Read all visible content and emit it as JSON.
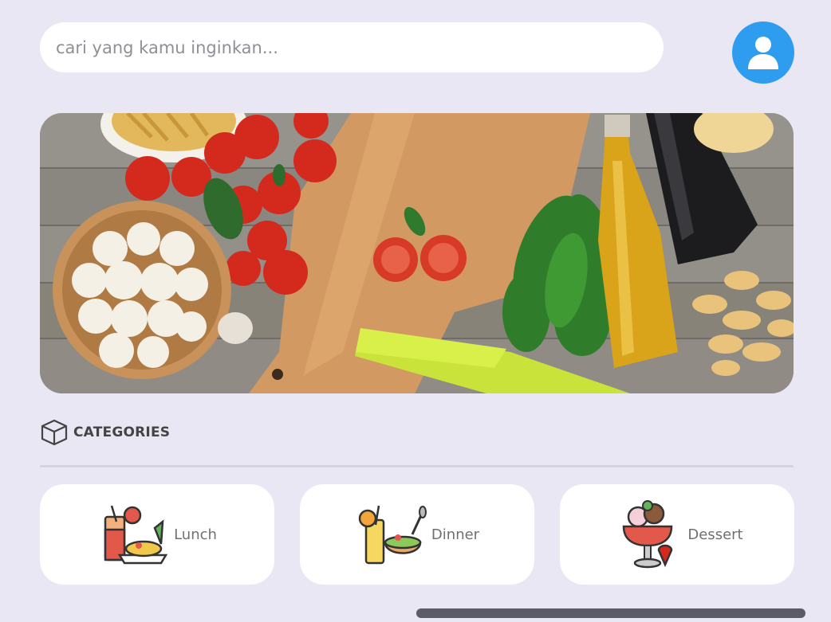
{
  "search": {
    "placeholder": "cari yang kamu inginkan..."
  },
  "profile": {
    "icon": "user-icon",
    "color": "#2e9df0"
  },
  "banner": {
    "description_icon": "food-ingredients-image"
  },
  "categories": {
    "title": "CATEGORIES",
    "icon": "box-icon",
    "items": [
      {
        "label": "Lunch",
        "icon": "lunch-icon"
      },
      {
        "label": "Dinner",
        "icon": "dinner-icon"
      },
      {
        "label": "Dessert",
        "icon": "dessert-icon"
      }
    ]
  },
  "colors": {
    "background": "#e8e7f3",
    "accent": "#2e9df0",
    "card": "#ffffff"
  }
}
